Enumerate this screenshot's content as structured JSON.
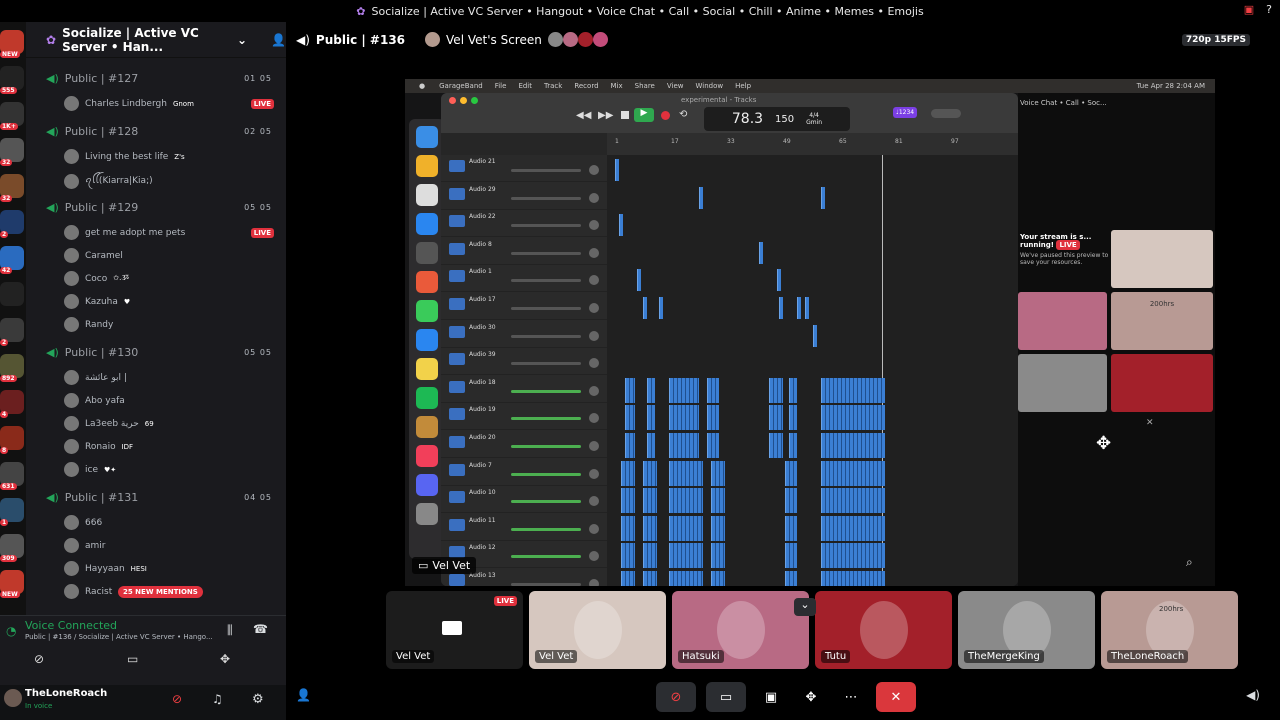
{
  "window": {
    "title": "Socialize | Active VC Server • Hangout • Voice Chat • Call • Social • Chill • Anime • Memes • Emojis"
  },
  "servers": [
    {
      "badge": "NEW",
      "color": "#c0392b"
    },
    {
      "badge": "555",
      "color": "#222"
    },
    {
      "badge": "1K+",
      "color": "#333"
    },
    {
      "badge": "32",
      "color": "#555"
    },
    {
      "badge": "32",
      "color": "#7a4b2a"
    },
    {
      "badge": "2",
      "color": "#1f3b6b"
    },
    {
      "badge": "42",
      "color": "#2a6bbf"
    },
    {
      "badge": "",
      "color": "#222"
    },
    {
      "badge": "2",
      "color": "#3a3a3a"
    },
    {
      "badge": "892",
      "color": "#553"
    },
    {
      "badge": "4",
      "color": "#6b1f1f"
    },
    {
      "badge": "8",
      "color": "#8a2a1a"
    },
    {
      "badge": "631",
      "color": "#444"
    },
    {
      "badge": "1",
      "color": "#2a4d6b"
    },
    {
      "badge": "309",
      "color": "#555"
    },
    {
      "badge": "NEW",
      "color": "#c0392b"
    }
  ],
  "sidebar": {
    "server_name": "Socialize | Active VC Server • Han...",
    "channels": [
      {
        "name": "Public | #127",
        "count": "01 05",
        "users": [
          {
            "name": "Charles Lindbergh",
            "tag": "Gnom",
            "live": "LIVE"
          }
        ]
      },
      {
        "name": "Public | #128",
        "count": "02 05",
        "users": [
          {
            "name": "Living the best life",
            "tag": "Z's"
          },
          {
            "name": "ꪖꪶꪶ(Kiarra|Kia;)",
            "tag": ""
          }
        ]
      },
      {
        "name": "Public | #129",
        "count": "05 05",
        "users": [
          {
            "name": "get me adopt me pets",
            "tag": "",
            "live": "LIVE"
          },
          {
            "name": "Caramel",
            "tag": ""
          },
          {
            "name": "Coco",
            "tag": "✩.ૐ"
          },
          {
            "name": "Kazuha",
            "tag": "♥"
          },
          {
            "name": "Randy",
            "tag": ""
          }
        ]
      },
      {
        "name": "Public | #130",
        "count": "05 05",
        "users": [
          {
            "name": "ابو عائشة |",
            "tag": ""
          },
          {
            "name": "Abo yafa",
            "tag": ""
          },
          {
            "name": "La3eeb حرية",
            "tag": "69"
          },
          {
            "name": "Ronaio",
            "tag": "IDF"
          },
          {
            "name": "ice",
            "tag": "♥✦"
          }
        ]
      },
      {
        "name": "Public | #131",
        "count": "04 05",
        "users": [
          {
            "name": "666",
            "tag": ""
          },
          {
            "name": "amir",
            "tag": ""
          },
          {
            "name": "Hayyaan",
            "tag": "HESI"
          },
          {
            "name": "Racist",
            "tag": ""
          }
        ]
      }
    ],
    "new_mentions": "25 NEW MENTIONS",
    "voice": {
      "status": "Voice Connected",
      "detail": "Public | #136 / Socialize | Active VC Server • Hango..."
    },
    "user": {
      "name": "TheLoneRoach",
      "status": "In voice"
    }
  },
  "stage": {
    "channel": "Public | #136",
    "screen_label": "Vel Vet's Screen",
    "quality": "720p 15FPS",
    "stream_user": "Vel Vet"
  },
  "garageband": {
    "menu": [
      "GarageBand",
      "File",
      "Edit",
      "Track",
      "Record",
      "Mix",
      "Share",
      "View",
      "Window",
      "Help"
    ],
    "clock": "Tue Apr 28 2:04 AM",
    "project": "experimental - Tracks",
    "position": "78.3",
    "tempo": "150",
    "signature": "4/4",
    "key": "Gmin",
    "ruler": [
      "1",
      "17",
      "33",
      "49",
      "65",
      "81",
      "97"
    ],
    "tracks": [
      "Audio 21",
      "Audio 29",
      "Audio 22",
      "Audio 8",
      "Audio 1",
      "Audio 17",
      "Audio 30",
      "Audio 39",
      "Audio 18",
      "Audio 19",
      "Audio 20",
      "Audio 7",
      "Audio 10",
      "Audio 11",
      "Audio 12",
      "Audio 13"
    ],
    "side_title": "Voice Chat • Call • Soc...",
    "paused_title": "Your stream is s... running!",
    "paused_live": "LIVE",
    "paused_text": "We've paused this preview to save your resources.",
    "mini_label": "200hrs"
  },
  "tiles": [
    {
      "name": "Vel Vet",
      "live": "LIVE",
      "color": "#1c1c1c"
    },
    {
      "name": "Vel Vet",
      "color": "#d6c7bf"
    },
    {
      "name": "Hatsuki",
      "color": "#b86a84"
    },
    {
      "name": "Tutu",
      "color": "#a3202a"
    },
    {
      "name": "TheMergeKing",
      "color": "#8a8a8a"
    },
    {
      "name": "TheLoneRoach",
      "color": "#b89a94",
      "label": "200hrs"
    }
  ]
}
